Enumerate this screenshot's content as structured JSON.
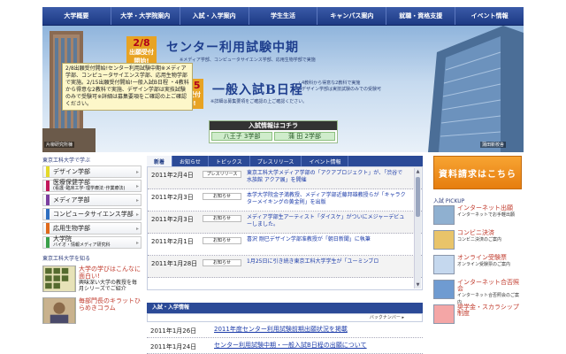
{
  "nav": [
    "大学概要",
    "大学・大学院案内",
    "入試・入学案内",
    "学生生活",
    "キャンパス案内",
    "就職・資格支援",
    "イベント情報"
  ],
  "hero": {
    "badge1": {
      "date": "2/8",
      "line1": "出願受付",
      "line2": "開始!"
    },
    "title1": "センター利用試験中期",
    "sub1": "※メディア学部、コンピュータサイエンス学部、応用生物学部で実施",
    "badge2": {
      "date": "2/15",
      "line1": "出願受付",
      "line2": "開始!"
    },
    "title2": "一般入試B日程",
    "sub2a": "・4教科から得意な2教科で実施",
    "sub2b": "・デザイン学部は実技試験のみでの受験可",
    "sub2c": "※詳細は募集要項をご確認の上ご確認ください。",
    "tooltip": "2/8出願受付開始!センター利用試験中期※メディア学部、コンピュータサイエンス学部、応用生物学部で実施。2/15出願受付開始!一般入試B日程 ・4教科から得意な2教科で実施、デザイン学部は実技試験のみで受験可※詳細は募集要項をご確認の上ご確認ください。",
    "caption_left": "片柳研究所棟",
    "caption_right": "蒲田新校舎",
    "exam_head": "入試情報はコチラ",
    "exam_left": "八王子 3学部",
    "exam_right": "蒲 田 2学部"
  },
  "left": {
    "title": "東京工科大学で学ぶ",
    "cats": [
      {
        "label": "デザイン学部",
        "sub": "",
        "color": "#e4d92a"
      },
      {
        "label": "医療保健学部",
        "sub": "(看護･臨床工学･理学療法･作業療法)",
        "color": "#c2185b"
      },
      {
        "label": "メディア学部",
        "sub": "",
        "color": "#7b3fa0"
      },
      {
        "label": "コンピュータサイエンス学部",
        "sub": "",
        "color": "#2f6fc0"
      },
      {
        "label": "応用生物学部",
        "sub": "",
        "color": "#e06a1c"
      },
      {
        "label": "大学院",
        "sub": "バイオ・情報メディア研究科",
        "color": "#3aa04a"
      }
    ],
    "title2": "東京工科大学を知る",
    "features": [
      {
        "title": "大学の学びはこんなに面白い!",
        "desc": "興味深い大学の教授を毎月シリーズでご紹介"
      },
      {
        "title": "毎部門長のキラットひらめきコラム",
        "desc": ""
      }
    ]
  },
  "center": {
    "tabs": [
      "新着",
      "お知らせ",
      "トピックス",
      "プレスリリース",
      "イベント情報"
    ],
    "news": [
      {
        "date": "2011年2月4日",
        "tag": "プレスリリース",
        "text": "東京工科大学メディア学部の「アクアプロジェクト」が、「渋谷で水族館 アクア展」を開催"
      },
      {
        "date": "2011年2月3日",
        "tag": "お知らせ",
        "text": "本学大学院金子満教授、メディア学部近藤邦雄教授らが「キャラクターメイキングの黄金則」を出版"
      },
      {
        "date": "2011年2月3日",
        "tag": "お知らせ",
        "text": "メディア学部生アーティスト「ダイスケ」がついにメジャーデビューしました。"
      },
      {
        "date": "2011年2月1日",
        "tag": "お知らせ",
        "text": "喜沢 剛巳デザイン学部准教授が「朝日新聞」に執筆"
      },
      {
        "date": "2011年1月28日",
        "tag": "お知らせ",
        "text": "1月25日に引き続き東京工科大学学生が「ユーミンブロ"
      }
    ],
    "sec2_title": "入試・入学情報",
    "sec2_backnum": "バックナンバー ▸",
    "news2": [
      {
        "date": "2011年1月26日",
        "text": "2011年度センター利用試験前期出願状況を掲載"
      },
      {
        "date": "2011年1月24日",
        "text": "センター利用試験中期・一般入試B日程の出願について"
      }
    ]
  },
  "right": {
    "request": "資料請求はこちら",
    "pick_title": "入試 PICKUP",
    "items": [
      {
        "title": "インターネット出願",
        "desc": "インターネットでお手軽出願"
      },
      {
        "title": "コンビニ決済",
        "desc": "コンビニ決済のご案内"
      },
      {
        "title": "オンライン受験票",
        "desc": "オンライン受験票のご案内"
      },
      {
        "title": "インターネット合否照会",
        "desc": "インターネット合否照会のご案内"
      },
      {
        "title": "奨学金・スカラシップ制度",
        "desc": ""
      }
    ]
  }
}
